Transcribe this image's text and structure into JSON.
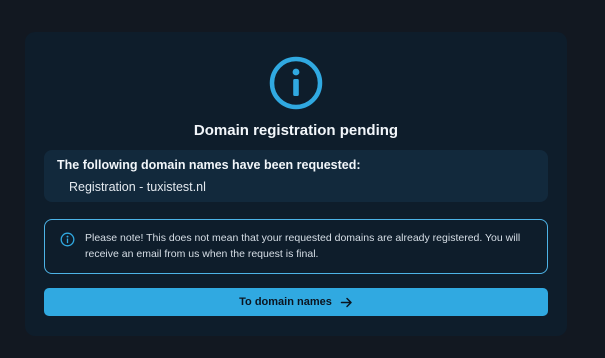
{
  "dialog": {
    "icon": "info-circle-icon",
    "title": "Domain registration pending",
    "requested": {
      "heading": "The following domain names have been requested:",
      "items": [
        "Registration - tuxistest.nl"
      ]
    },
    "notice": {
      "icon": "info-icon",
      "text": "Please note! This does not mean that your requested domains are already registered. You will receive an email from us when the request is final."
    },
    "primary_button": {
      "label": "To domain names",
      "icon": "arrow-right-icon"
    }
  },
  "colors": {
    "background": "#121821",
    "card": "#0e1d2b",
    "accent": "#30a9e1",
    "notice_border": "#4db3e6"
  }
}
